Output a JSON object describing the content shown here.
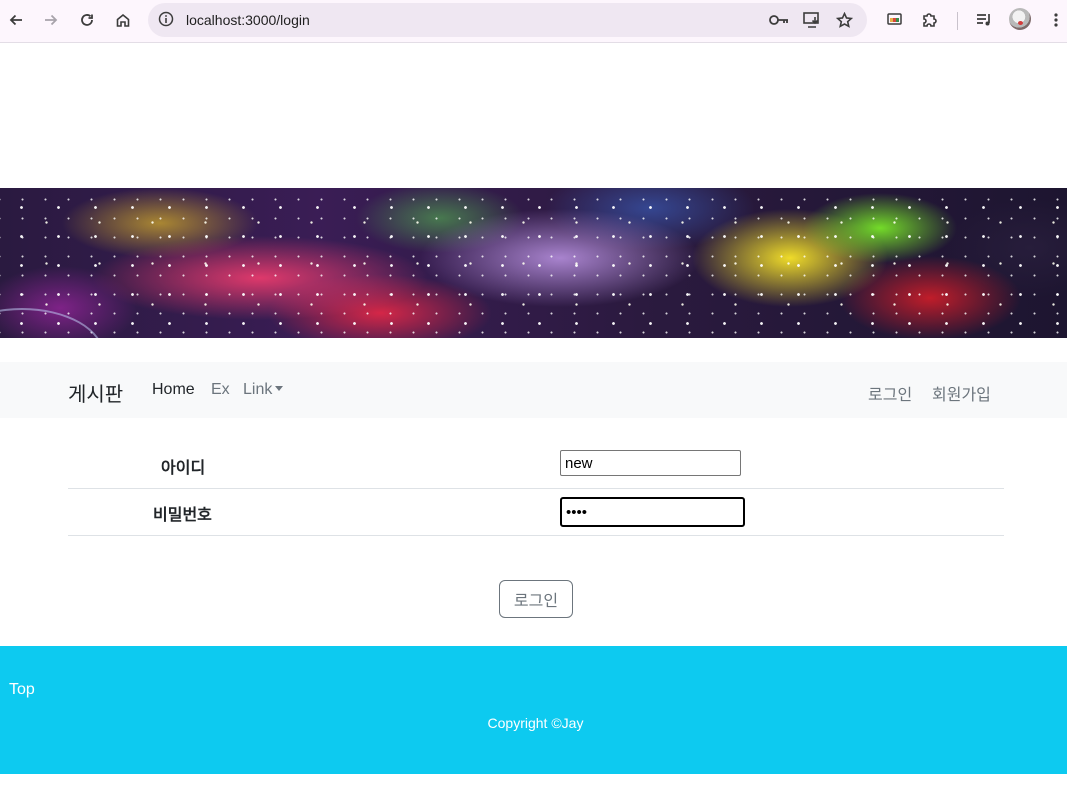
{
  "browser": {
    "url": "localhost:3000/login",
    "icons": {
      "back": "back-arrow-icon",
      "forward": "forward-arrow-icon",
      "reload": "reload-icon",
      "home": "home-icon",
      "site_info": "site-info-icon",
      "password_key": "key-icon",
      "install_app": "install-app-icon",
      "bookmark": "star-icon",
      "cast": "cast-icon",
      "extensions": "puzzle-icon",
      "media": "media-queue-icon",
      "menu": "kebab-menu-icon"
    }
  },
  "navbar": {
    "brand": "게시판",
    "links": [
      "Home",
      "Ex",
      "Link"
    ],
    "right_links": [
      "로그인",
      "회원가입"
    ]
  },
  "login": {
    "id_label": "아이디",
    "id_value": "new",
    "password_label": "비밀번호",
    "password_value": "1234",
    "submit_label": "로그인"
  },
  "footer": {
    "top_link": "Top",
    "copyright": "Copyright ©Jay",
    "background_color": "#0dcaf0"
  }
}
